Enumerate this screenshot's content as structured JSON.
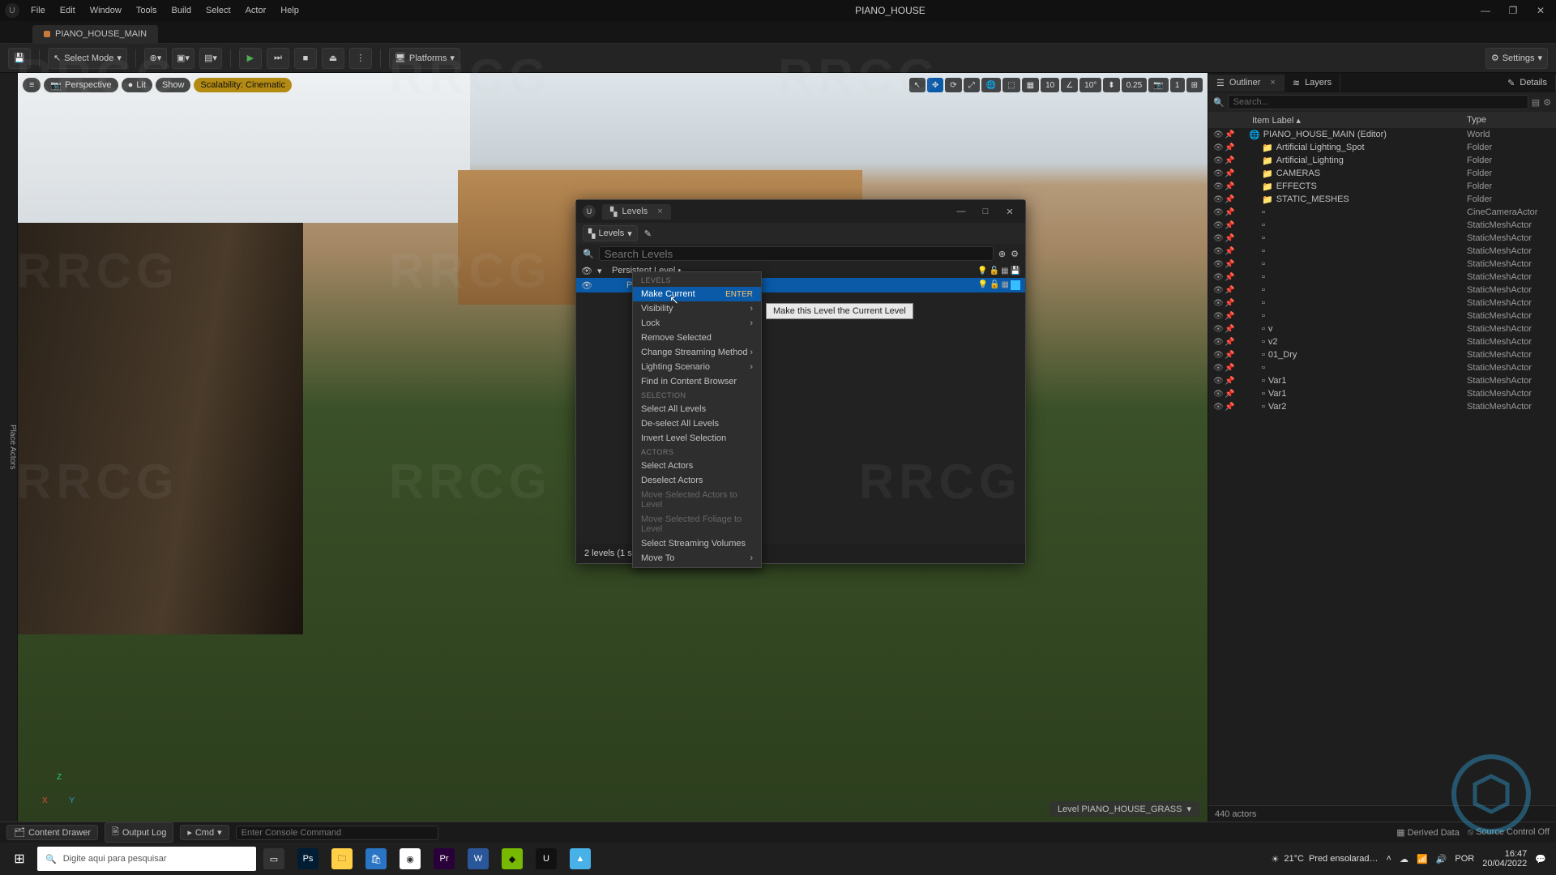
{
  "app": {
    "project_title": "PIANO_HOUSE"
  },
  "menubar": [
    "File",
    "Edit",
    "Window",
    "Tools",
    "Build",
    "Select",
    "Actor",
    "Help"
  ],
  "doctab": {
    "name": "PIANO_HOUSE_MAIN"
  },
  "toolbar": {
    "save": "Save",
    "select_mode": "Select Mode",
    "platforms": "Platforms",
    "settings": "Settings"
  },
  "viewport": {
    "perspective": "Perspective",
    "lit": "Lit",
    "show": "Show",
    "scalability": "Scalability: Cinematic",
    "grid_val": "10",
    "angle_val": "10°",
    "scale_val": "0.25",
    "cam_val": "1",
    "level_label": "Level  PIANO_HOUSE_GRASS"
  },
  "outliner": {
    "tab": "Outliner",
    "tab2": "Layers",
    "tab3": "Details",
    "search_placeholder": "Search...",
    "col_label": "Item Label",
    "col_type": "Type",
    "rows": [
      {
        "label": "PIANO_HOUSE_MAIN (Editor)",
        "type": "World",
        "indent": 1,
        "icon": "world"
      },
      {
        "label": "Artificial Lighting_Spot",
        "type": "Folder",
        "indent": 2,
        "icon": "folder"
      },
      {
        "label": "Artificial_Lighting",
        "type": "Folder",
        "indent": 2,
        "icon": "folder"
      },
      {
        "label": "CAMERAS",
        "type": "Folder",
        "indent": 2,
        "icon": "folder"
      },
      {
        "label": "EFFECTS",
        "type": "Folder",
        "indent": 2,
        "icon": "folder"
      },
      {
        "label": "STATIC_MESHES",
        "type": "Folder",
        "indent": 2,
        "icon": "folder"
      },
      {
        "label": "",
        "type": "CineCameraActor",
        "indent": 2,
        "icon": "actor"
      },
      {
        "label": "",
        "type": "StaticMeshActor",
        "indent": 2,
        "icon": "actor"
      },
      {
        "label": "",
        "type": "StaticMeshActor",
        "indent": 2,
        "icon": "actor"
      },
      {
        "label": "",
        "type": "StaticMeshActor",
        "indent": 2,
        "icon": "actor"
      },
      {
        "label": "",
        "type": "StaticMeshActor",
        "indent": 2,
        "icon": "actor"
      },
      {
        "label": "",
        "type": "StaticMeshActor",
        "indent": 2,
        "icon": "actor"
      },
      {
        "label": "",
        "type": "StaticMeshActor",
        "indent": 2,
        "icon": "actor"
      },
      {
        "label": "",
        "type": "StaticMeshActor",
        "indent": 2,
        "icon": "actor"
      },
      {
        "label": "",
        "type": "StaticMeshActor",
        "indent": 2,
        "icon": "actor"
      },
      {
        "label": "v",
        "type": "StaticMeshActor",
        "indent": 2,
        "icon": "actor"
      },
      {
        "label": "v2",
        "type": "StaticMeshActor",
        "indent": 2,
        "icon": "actor"
      },
      {
        "label": "01_Dry",
        "type": "StaticMeshActor",
        "indent": 2,
        "icon": "actor"
      },
      {
        "label": "",
        "type": "StaticMeshActor",
        "indent": 2,
        "icon": "actor"
      },
      {
        "label": "Var1",
        "type": "StaticMeshActor",
        "indent": 2,
        "icon": "actor"
      },
      {
        "label": "Var1",
        "type": "StaticMeshActor",
        "indent": 2,
        "icon": "actor"
      },
      {
        "label": "Var2",
        "type": "StaticMeshActor",
        "indent": 2,
        "icon": "actor"
      }
    ],
    "footer": "440 actors"
  },
  "levels_win": {
    "title": "Levels",
    "levels_btn": "Levels",
    "search_placeholder": "Search Levels",
    "persistent": "Persistent Level •",
    "sel_level": "PIA",
    "footer": "2 levels (1 selected)"
  },
  "context_menu": {
    "section_levels": "LEVELS",
    "make_current": "Make Current",
    "make_current_sc": "ENTER",
    "visibility": "Visibility",
    "lock": "Lock",
    "remove_selected": "Remove Selected",
    "change_streaming": "Change Streaming Method",
    "lighting_scenario": "Lighting Scenario",
    "find_in_cb": "Find in Content Browser",
    "section_selection": "SELECTION",
    "select_all": "Select All Levels",
    "deselect_all": "De-select All Levels",
    "invert": "Invert Level Selection",
    "section_actors": "ACTORS",
    "select_actors": "Select Actors",
    "deselect_actors": "Deselect Actors",
    "move_sel_actors": "Move Selected Actors to Level",
    "move_sel_foliage": "Move Selected Foliage to Level",
    "sel_stream_vol": "Select Streaming Volumes",
    "move_to": "Move To"
  },
  "tooltip": "Make this Level the Current Level",
  "statusbar": {
    "content_drawer": "Content Drawer",
    "output_log": "Output Log",
    "cmd_label": "Cmd",
    "cmd_placeholder": "Enter Console Command",
    "derived": "Derived Data",
    "source_ctrl": "Source Control Off"
  },
  "taskbar": {
    "search_placeholder": "Digite aqui para pesquisar",
    "weather_temp": "21°C",
    "weather_desc": "Pred ensolarad…",
    "time": "16:47",
    "date": "20/04/2022"
  },
  "left_gutter": "Place Actors",
  "watermark": "RRCG"
}
